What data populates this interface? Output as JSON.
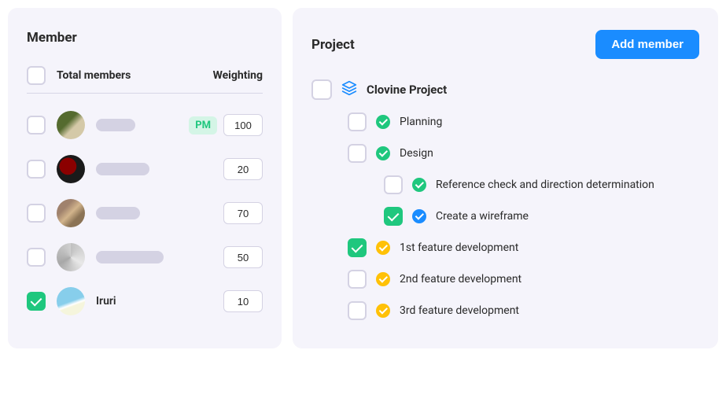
{
  "member_panel": {
    "title": "Member",
    "columns": {
      "total": "Total members",
      "weight": "Weighting"
    },
    "rows": [
      {
        "checked": false,
        "avatar": "avatar-1",
        "name": "",
        "placeholder_width": 50,
        "pm": true,
        "weight": "100"
      },
      {
        "checked": false,
        "avatar": "avatar-2",
        "name": "",
        "placeholder_width": 68,
        "pm": false,
        "weight": "20"
      },
      {
        "checked": false,
        "avatar": "avatar-3",
        "name": "",
        "placeholder_width": 56,
        "pm": false,
        "weight": "70"
      },
      {
        "checked": false,
        "avatar": "avatar-4",
        "name": "",
        "placeholder_width": 86,
        "pm": false,
        "weight": "50"
      },
      {
        "checked": true,
        "avatar": "avatar-5",
        "name": "Iruri",
        "placeholder_width": 0,
        "pm": false,
        "weight": "10"
      }
    ],
    "pm_label": "PM"
  },
  "project_panel": {
    "title": "Project",
    "add_button": "Add member",
    "root": {
      "name": "Clovine Project",
      "checked": false
    },
    "items": [
      {
        "level": 1,
        "checked": false,
        "status": "green",
        "label": "Planning"
      },
      {
        "level": 1,
        "checked": false,
        "status": "green",
        "label": "Design"
      },
      {
        "level": 2,
        "checked": false,
        "status": "green",
        "label": "Reference check and direction determination"
      },
      {
        "level": 2,
        "checked": true,
        "status": "blue",
        "label": "Create a wireframe"
      },
      {
        "level": 1,
        "checked": true,
        "status": "yellow",
        "label": "1st feature development"
      },
      {
        "level": 1,
        "checked": false,
        "status": "yellow",
        "label": "2nd feature development"
      },
      {
        "level": 1,
        "checked": false,
        "status": "yellow",
        "label": "3rd feature development"
      }
    ]
  }
}
